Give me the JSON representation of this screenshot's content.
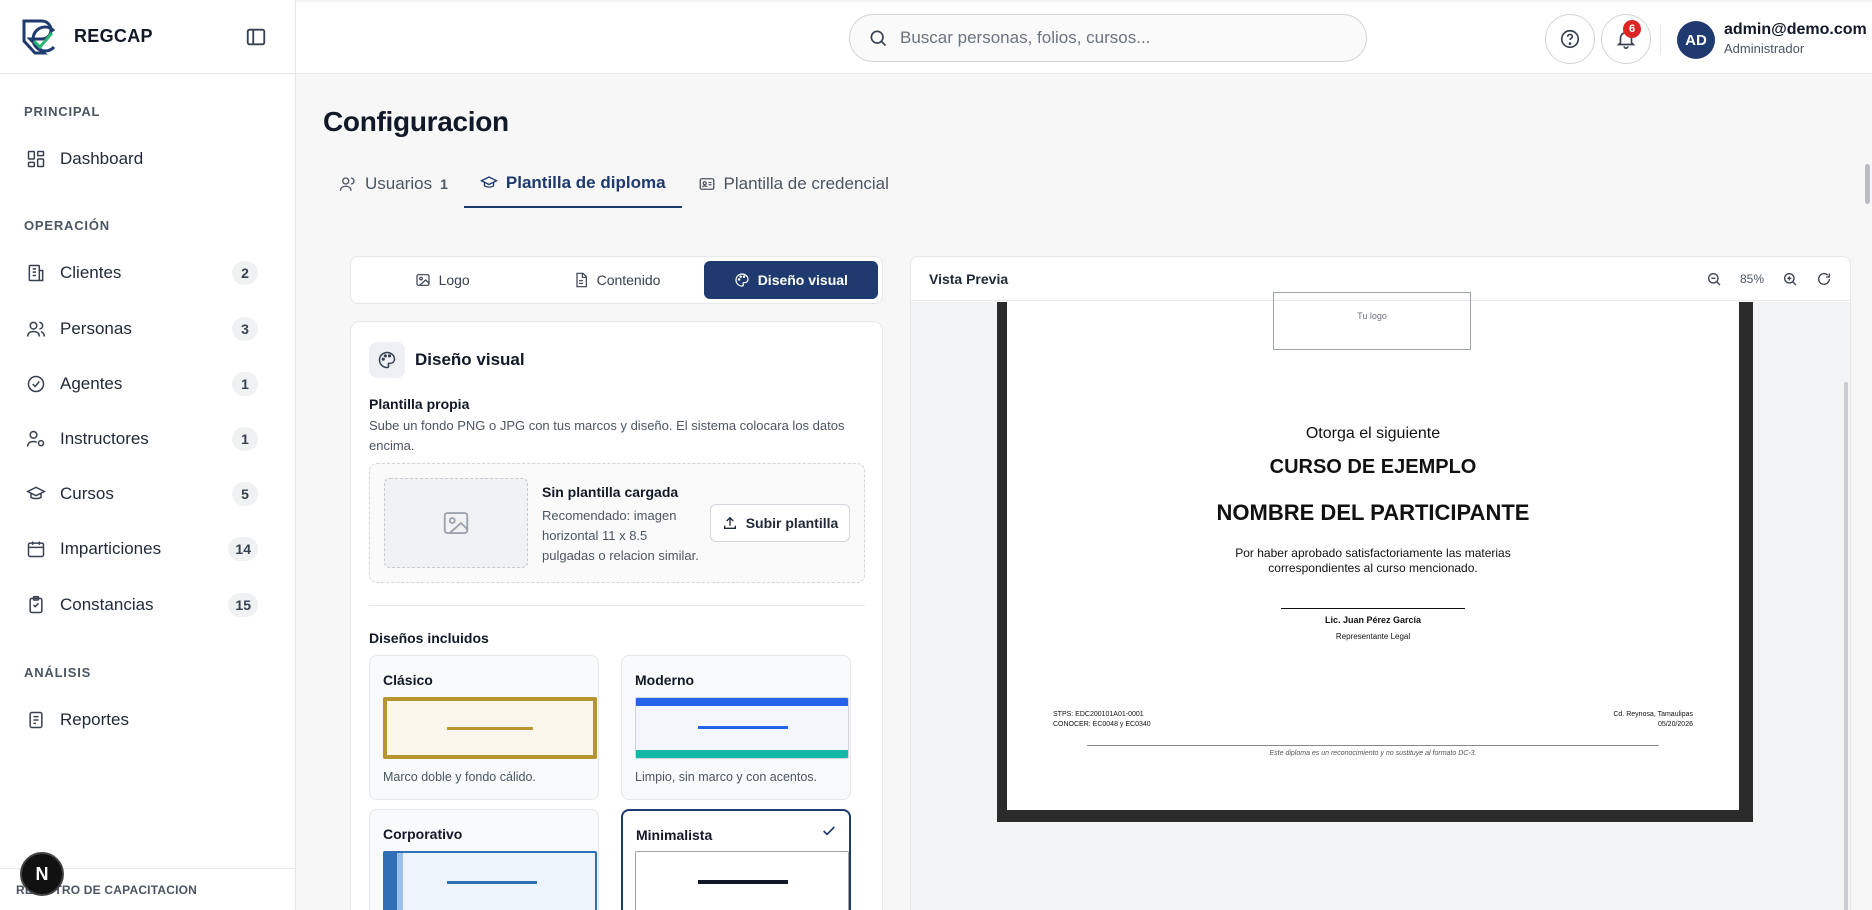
{
  "app": {
    "name": "REGCAP",
    "footer": "REGISTRO DE CAPACITACION",
    "floating_badge": "N"
  },
  "sidebar": {
    "sections": [
      {
        "title": "PRINCIPAL"
      },
      {
        "title": "OPERACIÓN"
      },
      {
        "title": "ANÁLISIS"
      }
    ],
    "items": [
      {
        "label": "Dashboard",
        "icon": "dashboard-icon",
        "badge": ""
      },
      {
        "label": "Clientes",
        "icon": "building-icon",
        "badge": "2"
      },
      {
        "label": "Personas",
        "icon": "users-icon",
        "badge": "3"
      },
      {
        "label": "Agentes",
        "icon": "check-circle-icon",
        "badge": "1"
      },
      {
        "label": "Instructores",
        "icon": "user-cog-icon",
        "badge": "1"
      },
      {
        "label": "Cursos",
        "icon": "graduation-cap-icon",
        "badge": "5"
      },
      {
        "label": "Imparticiones",
        "icon": "calendar-icon",
        "badge": "14"
      },
      {
        "label": "Constancias",
        "icon": "clipboard-icon",
        "badge": "15"
      },
      {
        "label": "Reportes",
        "icon": "report-icon",
        "badge": ""
      }
    ]
  },
  "topbar": {
    "search_placeholder": "Buscar personas, folios, cursos...",
    "notification_count": "6",
    "user_initials": "AD",
    "user_email": "admin@demo.com",
    "user_role": "Administrador"
  },
  "page": {
    "title": "Configuracion",
    "tabs": [
      {
        "label": "Usuarios",
        "count": "1"
      },
      {
        "label": "Plantilla de diploma",
        "count": ""
      },
      {
        "label": "Plantilla de credencial",
        "count": ""
      }
    ],
    "active_tab": "Plantilla de diploma"
  },
  "editor": {
    "subtabs": [
      {
        "label": "Logo"
      },
      {
        "label": "Contenido"
      },
      {
        "label": "Diseño visual"
      }
    ],
    "active_subtab": "Diseño visual",
    "card_title": "Diseño visual",
    "own_template_title": "Plantilla propia",
    "own_template_desc": "Sube un fondo PNG o JPG con tus marcos y diseño. El sistema colocara los datos encima.",
    "upload_title": "Sin plantilla cargada",
    "upload_desc": "Recomendado: imagen horizontal 11 x 8.5 pulgadas o relacion similar.",
    "upload_button": "Subir plantilla",
    "included_title": "Diseños incluidos",
    "templates": [
      {
        "name": "Clásico",
        "desc": "Marco doble y fondo cálido.",
        "accent": "#b8962e"
      },
      {
        "name": "Moderno",
        "desc": "Limpio, sin marco y con acentos.",
        "accent": "#2563eb"
      },
      {
        "name": "Corporativo",
        "desc": "",
        "accent": "#2f6fb5"
      },
      {
        "name": "Minimalista",
        "desc": "",
        "accent": "#111827",
        "selected": true
      }
    ]
  },
  "preview": {
    "title": "Vista Previa",
    "zoom": "85%",
    "diploma": {
      "logo_placeholder": "Tu logo",
      "otorga": "Otorga el siguiente",
      "curso": "CURSO DE EJEMPLO",
      "nombre": "NOMBRE DEL PARTICIPANTE",
      "texto": "Por haber aprobado satisfactoriamente las materias correspondientes al curso mencionado.",
      "firma": "Lic. Juan Pérez García",
      "cargo": "Representante Legal",
      "left_line1": "STPS: EDC200101A01-0001",
      "left_line2": "CONOCER: EC0048 y EC0340",
      "right_line1": "Cd. Reynosa, Tamaulipas",
      "right_line2": "05/20/2026",
      "nota": "Este diploma es un reconocimiento y no sustituye al formato DC-3."
    }
  },
  "colors": {
    "primary": "#1e3a6e",
    "badge_red": "#dc2626"
  }
}
